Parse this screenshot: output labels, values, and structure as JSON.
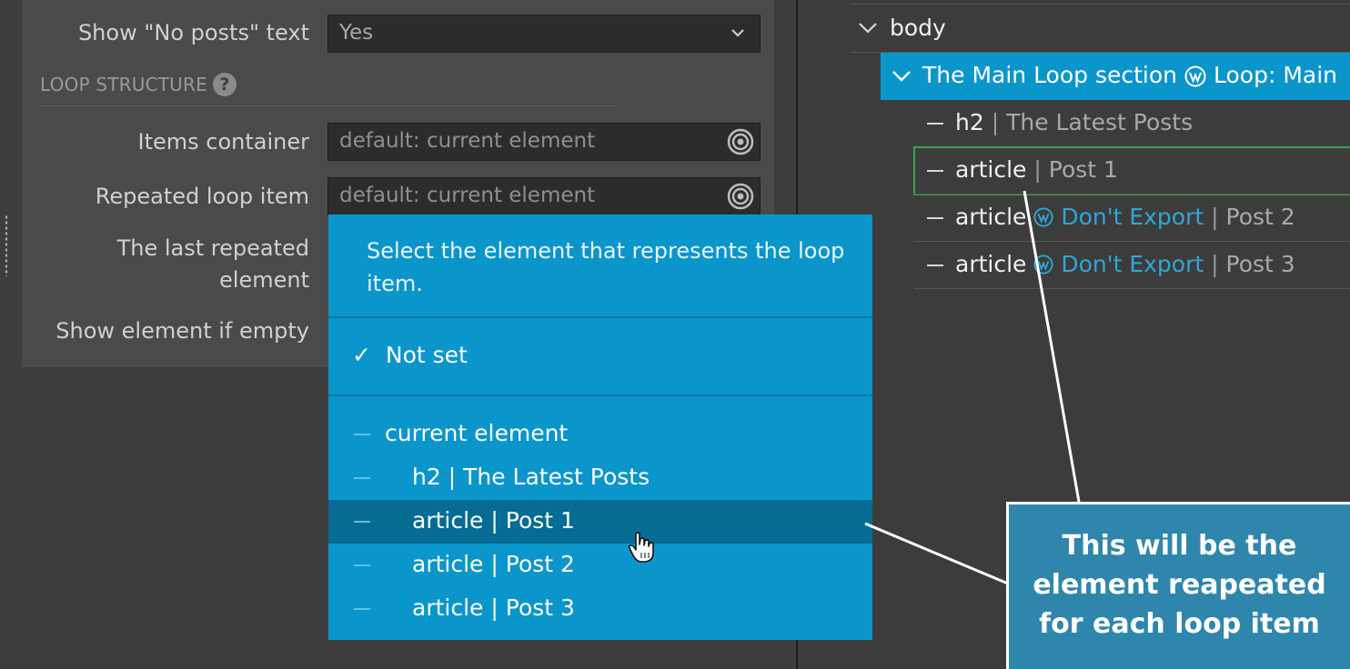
{
  "settings": {
    "no_posts_label": "Show \"No posts\" text",
    "no_posts_value": "Yes",
    "section_title": "LOOP STRUCTURE",
    "help_glyph": "?",
    "items_container_label": "Items container",
    "items_container_placeholder": "default: current element",
    "repeated_item_label": "Repeated loop item",
    "repeated_item_placeholder": "default: current element",
    "last_repeated_label": "The last repeated element",
    "show_if_empty_label": "Show element if empty"
  },
  "dropdown": {
    "header": "Select the element that represents the loop item.",
    "check_glyph": "✓",
    "not_set": "Not set",
    "items": [
      {
        "label": "current element"
      },
      {
        "tag": "h2",
        "sep": "|",
        "name": "The Latest Posts"
      },
      {
        "tag": "article",
        "sep": "|",
        "name": "Post 1",
        "highlighted": true
      },
      {
        "tag": "article",
        "sep": "|",
        "name": "Post 2"
      },
      {
        "tag": "article",
        "sep": "|",
        "name": "Post 3"
      }
    ]
  },
  "tree": {
    "body": "body",
    "section": "The Main Loop section",
    "loop_badge": "Loop: Main",
    "rows": [
      {
        "tag": "h2",
        "sep": "|",
        "name": "The Latest Posts"
      },
      {
        "tag": "article",
        "sep": "|",
        "name": "Post 1"
      },
      {
        "tag": "article",
        "link": "Don't Export",
        "sep": "|",
        "name": "Post 2"
      },
      {
        "tag": "article",
        "link": "Don't Export",
        "sep": "|",
        "name": "Post 3"
      }
    ]
  },
  "callout": {
    "text": "This will be the element reapeated for each loop item"
  },
  "colors": {
    "accent": "#0b96cb",
    "highlight": "#066c93",
    "callout": "#2e86ad",
    "link": "#2fa6d8",
    "outline": "#3aa24d"
  },
  "icons": [
    "chevron-down-icon",
    "target-icon",
    "help-icon",
    "checkmark-icon",
    "wordpress-icon",
    "hand-cursor-icon"
  ]
}
